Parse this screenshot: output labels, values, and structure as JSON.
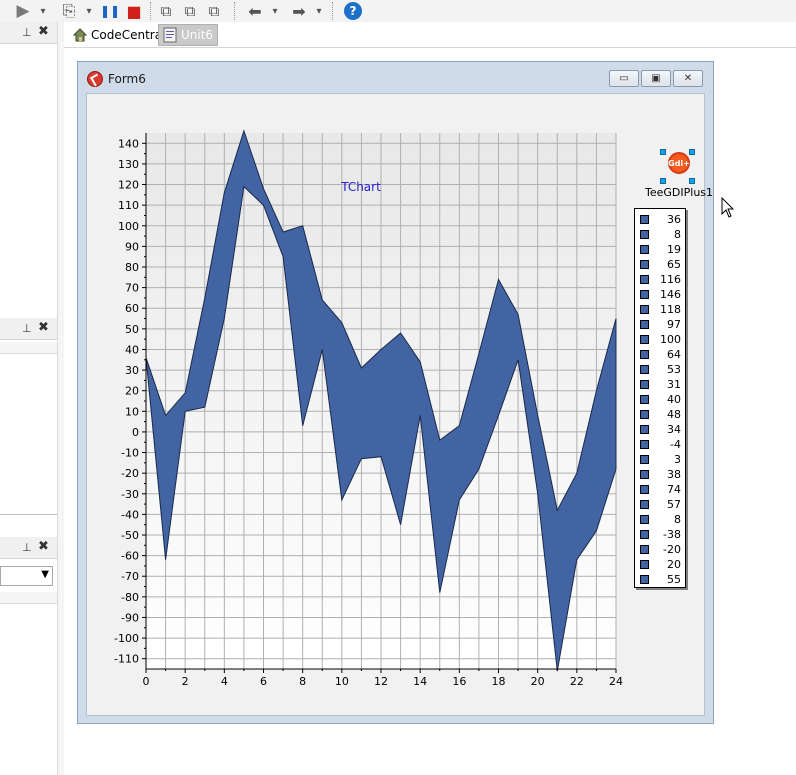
{
  "toolbar": {
    "buttons": [
      {
        "name": "run-icon",
        "label": "▶"
      },
      {
        "name": "run-dropdown-icon",
        "label": "▾"
      },
      {
        "name": "step-over-icon",
        "label": "⎘"
      },
      {
        "name": "step-dropdown-icon",
        "label": "▾"
      },
      {
        "name": "pause-icon",
        "label": "❚❚"
      },
      {
        "name": "stop-icon",
        "label": "■"
      },
      {
        "name": "copy-form-icon",
        "label": "⧉"
      },
      {
        "name": "paste-form-icon",
        "label": "⧉"
      },
      {
        "name": "align-icon",
        "label": "⧉"
      },
      {
        "name": "back-icon",
        "label": "⬅"
      },
      {
        "name": "back-dropdown-icon",
        "label": "▾"
      },
      {
        "name": "forward-icon",
        "label": "➡"
      },
      {
        "name": "forward-dropdown-icon",
        "label": "▾"
      },
      {
        "name": "help-icon",
        "label": "?"
      }
    ]
  },
  "dock": {
    "pin": "⊥",
    "close": "✖"
  },
  "tabs": [
    {
      "label": "CodeCentral",
      "icon": "home-icon"
    },
    {
      "label": "Unit6",
      "icon": "unit-file-icon"
    }
  ],
  "form": {
    "title": "Form6",
    "buttons": {
      "minimize": "▭",
      "maximize": "▣",
      "close": "✕"
    },
    "component_label": "TeeGDIPlus1",
    "component_icon_text": "Gdi+"
  },
  "chart_data": {
    "type": "area",
    "title": "TChart",
    "xlabel": "",
    "ylabel": "",
    "xlim": [
      0,
      24
    ],
    "ylim": [
      -115,
      145
    ],
    "x_ticks": [
      0,
      2,
      4,
      6,
      8,
      10,
      12,
      14,
      16,
      18,
      20,
      22,
      24
    ],
    "y_ticks": [
      -110,
      -100,
      -90,
      -80,
      -70,
      -60,
      -50,
      -40,
      -30,
      -20,
      -10,
      0,
      10,
      20,
      30,
      40,
      50,
      60,
      70,
      80,
      90,
      100,
      110,
      120,
      130,
      140
    ],
    "grid": true,
    "legend_position": "right",
    "color": "#4264a3",
    "series": [
      {
        "values": [
          36,
          8,
          19,
          65,
          116,
          146,
          118,
          97,
          100,
          64,
          53,
          31,
          40,
          48,
          34,
          -4,
          3,
          38,
          74,
          57,
          8,
          -38,
          -20,
          20,
          55
        ]
      },
      {
        "values": [
          36,
          -62,
          10,
          12,
          55,
          119,
          110,
          85,
          3,
          40,
          -33,
          -13,
          -12,
          -45,
          8,
          -78,
          -33,
          -18,
          8,
          35,
          -30,
          -116,
          -62,
          -48,
          -18
        ]
      }
    ],
    "legend_entries": [
      "36",
      "8",
      "19",
      "65",
      "116",
      "146",
      "118",
      "97",
      "100",
      "64",
      "53",
      "31",
      "40",
      "48",
      "34",
      "-4",
      "3",
      "38",
      "74",
      "57",
      "8",
      "-38",
      "-20",
      "20",
      "55"
    ]
  }
}
